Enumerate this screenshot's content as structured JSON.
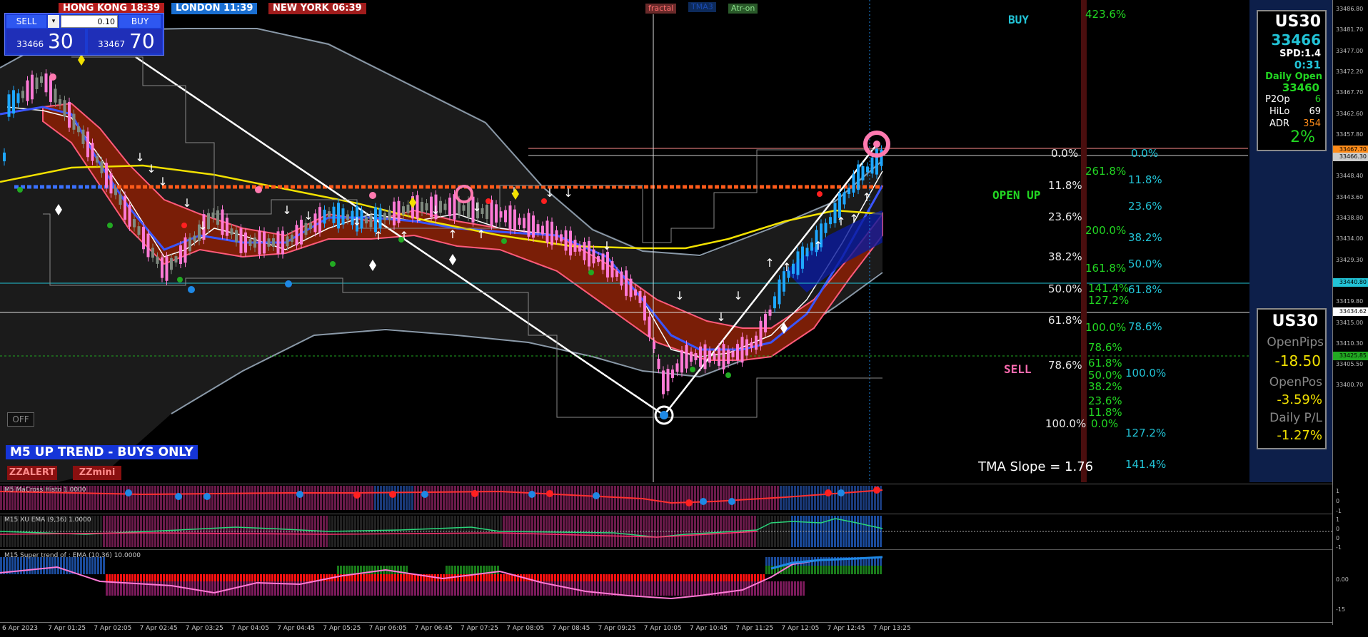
{
  "sessions": [
    {
      "city": "HONG KONG",
      "time": "18:39",
      "color": "#b51d1d"
    },
    {
      "city": "LONDON",
      "time": "11:39",
      "color": "#1a6fd1"
    },
    {
      "city": "NEW YORK",
      "time": "06:39",
      "color": "#a01c1c"
    }
  ],
  "trade_panel": {
    "sell_label": "SELL",
    "buy_label": "BUY",
    "lot_value": "0.10",
    "bid_prefix": "33466",
    "bid_big": "30",
    "ask_prefix": "33467",
    "ask_big": "70"
  },
  "top_buttons": {
    "fractal": "fractal",
    "tma": "TMA3",
    "atr": "Atr-on"
  },
  "signals": {
    "buy": "BUY",
    "open_up": "OPEN UP",
    "sell": "SELL"
  },
  "fib_white": [
    {
      "label": "0.0%"
    },
    {
      "label": "11.8%"
    },
    {
      "label": "23.6%"
    },
    {
      "label": "38.2%"
    },
    {
      "label": "50.0%"
    },
    {
      "label": "61.8%"
    },
    {
      "label": "78.6%"
    },
    {
      "label": "100.0%"
    }
  ],
  "fib_green": [
    {
      "label": "423.6%"
    },
    {
      "label": "261.8%"
    },
    {
      "label": "200.0%"
    },
    {
      "label": "161.8%"
    },
    {
      "label": "141.4%"
    },
    {
      "label": "127.2%"
    },
    {
      "label": "100.0%"
    },
    {
      "label": "78.6%"
    },
    {
      "label": "61.8%"
    },
    {
      "label": "50.0%"
    },
    {
      "label": "38.2%"
    },
    {
      "label": "23.6%"
    },
    {
      "label": "11.8%"
    },
    {
      "label": "0.0%"
    }
  ],
  "fib_cyan": [
    {
      "label": "0.0%"
    },
    {
      "label": "11.8%"
    },
    {
      "label": "23.6%"
    },
    {
      "label": "38.2%"
    },
    {
      "label": "50.0%"
    },
    {
      "label": "61.8%"
    },
    {
      "label": "78.6%"
    },
    {
      "label": "100.0%"
    },
    {
      "label": "127.2%"
    },
    {
      "label": "141.4%"
    }
  ],
  "tma_slope": "TMA Slope = 1.76",
  "trend_banner": "M5 UP TREND - BUYS ONLY",
  "off_button": "OFF",
  "zz_buttons": {
    "alert": "ZZALERT",
    "mini": "ZZmini"
  },
  "info_box": {
    "symbol": "US30",
    "price": "33466",
    "spread": "SPD:1.4",
    "timer": "0:31",
    "daily_open_label": "Daily Open",
    "daily_open": "33460",
    "p2op_label": "P2Op",
    "p2op": "6",
    "hilo_label": "HiLo",
    "hilo": "69",
    "adr_label": "ADR",
    "adr": "354",
    "percent": "2%"
  },
  "pos_box": {
    "symbol": "US30",
    "open_pips_label": "OpenPips",
    "open_pips": "-18.50",
    "open_pos_label": "OpenPos",
    "open_pos": "-3.59%",
    "daily_pl_label": "Daily P/L",
    "daily_pl": "-1.27%"
  },
  "price_axis": [
    "33486.80",
    "33481.70",
    "33477.00",
    "33472.20",
    "33467.70",
    "33462.60",
    "33457.80",
    "33453.10",
    "33448.40",
    "33443.60",
    "33438.80",
    "33434.00",
    "33429.30",
    "33424.60",
    "33419.80",
    "33415.00",
    "33410.30",
    "33405.50",
    "33400.70"
  ],
  "price_tags": [
    {
      "value": "33467.70",
      "color": "#ff8c1a"
    },
    {
      "value": "33466.30",
      "color": "#cccccc"
    },
    {
      "value": "33440.80",
      "color": "#22c3d6"
    },
    {
      "value": "33434.62",
      "color": "#ffffff"
    },
    {
      "value": "33425.85",
      "color": "#22aa22"
    }
  ],
  "panes": {
    "p1": {
      "title": "M5 MaCross Histo 1.0000",
      "scale": [
        "1",
        "0",
        "-1"
      ]
    },
    "p2": {
      "title": "M15 XU EMA (9,36) 1.0000",
      "scale": [
        "1",
        "0",
        "0",
        "-1"
      ]
    },
    "p3": {
      "title": "M15  Super trend of : EMA (10,36)  10.0000",
      "scale": [
        "0.00",
        "-15"
      ]
    }
  },
  "time_axis": [
    "6 Apr 2023",
    "7 Apr 01:25",
    "7 Apr 02:05",
    "7 Apr 02:45",
    "7 Apr 03:25",
    "7 Apr 04:05",
    "7 Apr 04:45",
    "7 Apr 05:25",
    "7 Apr 06:05",
    "7 Apr 06:45",
    "7 Apr 07:25",
    "7 Apr 08:05",
    "7 Apr 08:45",
    "7 Apr 09:25",
    "7 Apr 10:05",
    "7 Apr 10:45",
    "7 Apr 11:25",
    "7 Apr 12:05",
    "7 Apr 12:45",
    "7 Apr 13:25"
  ]
}
